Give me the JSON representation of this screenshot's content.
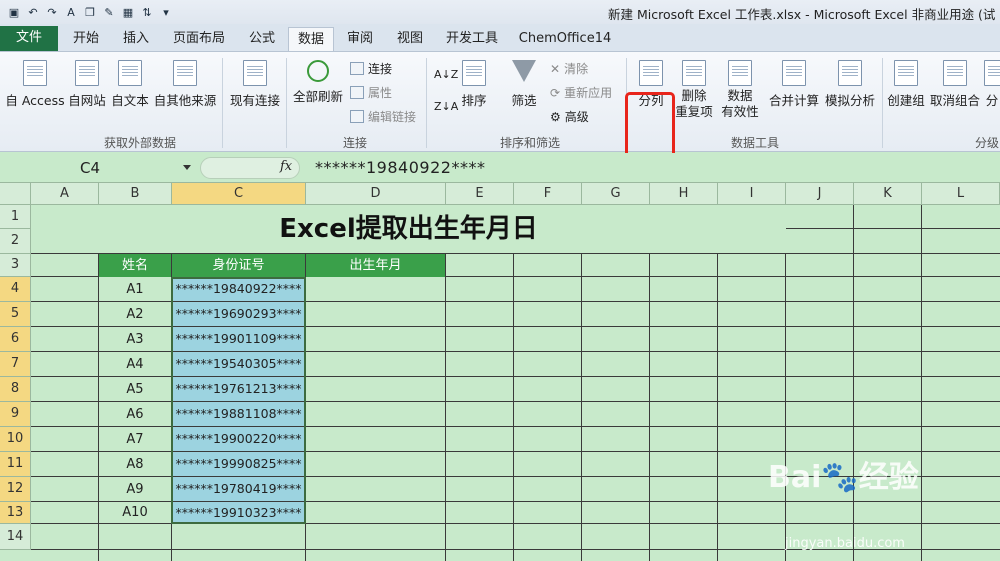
{
  "window": {
    "title": "新建 Microsoft Excel 工作表.xlsx - Microsoft Excel 非商业用途 (试"
  },
  "tabs": [
    "文件",
    "开始",
    "插入",
    "页面布局",
    "公式",
    "数据",
    "审阅",
    "视图",
    "开发工具",
    "ChemOffice14"
  ],
  "ribbon": {
    "get_external": [
      "自 Access",
      "自网站",
      "自文本",
      "自其他来源",
      "现有连接"
    ],
    "refresh_all": "全部刷新",
    "connections": [
      "连接",
      "属性",
      "编辑链接"
    ],
    "sort": "排序",
    "filter": "筛选",
    "filter_small": [
      "清除",
      "重新应用",
      "高级"
    ],
    "text_to_columns": "分列",
    "remove_dup": [
      "删除",
      "重复项"
    ],
    "validation": [
      "数据",
      "有效性"
    ],
    "consolidate": "合并计算",
    "whatif": "模拟分析",
    "group": "创建组",
    "ungroup": "取消组合",
    "subtotal": "分",
    "groups": [
      "获取外部数据",
      "连接",
      "排序和筛选",
      "数据工具",
      "分级"
    ]
  },
  "formula_bar": {
    "name_box": "C4",
    "fx": "fx",
    "content": "******19840922****"
  },
  "grid": {
    "columns": [
      "A",
      "B",
      "C",
      "D",
      "E",
      "F",
      "G",
      "H",
      "I",
      "J",
      "K",
      "L"
    ],
    "rows": [
      "1",
      "2",
      "3",
      "4",
      "5",
      "6",
      "7",
      "8",
      "9",
      "10",
      "11",
      "12",
      "13",
      "14"
    ],
    "title": "Excel提取出生年月日",
    "headers": [
      "姓名",
      "身份证号",
      "出生年月"
    ],
    "names": [
      "A1",
      "A2",
      "A3",
      "A4",
      "A5",
      "A6",
      "A7",
      "A8",
      "A9",
      "A10"
    ],
    "ids": [
      "******19840922****",
      "******19690293****",
      "******19901109****",
      "******19540305****",
      "******19761213****",
      "******19881108****",
      "******19900220****",
      "******19990825****",
      "******19780419****",
      "******19910323****"
    ]
  },
  "watermark": {
    "brand": "Bai",
    "brand2": "经验",
    "url": "jingyan.baidu.com"
  }
}
